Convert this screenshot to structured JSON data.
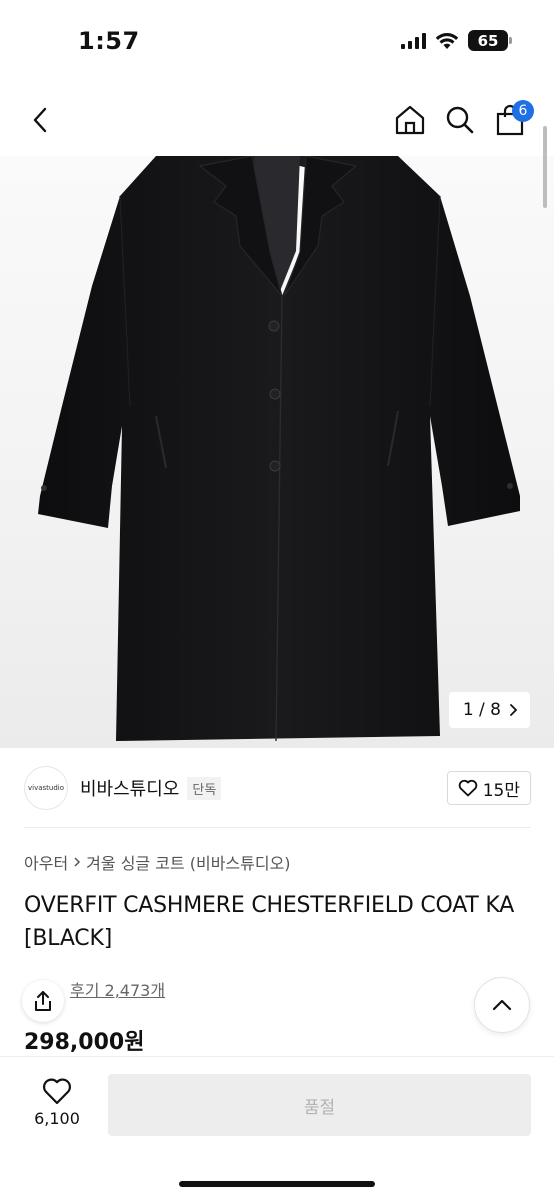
{
  "status_bar": {
    "time": "1:57",
    "battery": "65"
  },
  "nav": {
    "cart_count": "6"
  },
  "gallery": {
    "counter": "1 / 8"
  },
  "brand": {
    "logo_text": "vivastudio",
    "name": "비바스튜디오",
    "tag": "단독",
    "likes": "15만"
  },
  "breadcrumb": {
    "category": "아우터",
    "subcategory": "겨울 싱글 코트 (비바스튜디오)"
  },
  "product": {
    "title": "OVERFIT CASHMERE CHESTERFIELD COAT KA [BLACK]",
    "reviews": "후기 2,473개",
    "price": "298,000원"
  },
  "bottom": {
    "wish_count": "6,100",
    "soldout_label": "품절"
  },
  "colors": {
    "accent_badge": "#1f6fe5",
    "coat": "#141416"
  }
}
